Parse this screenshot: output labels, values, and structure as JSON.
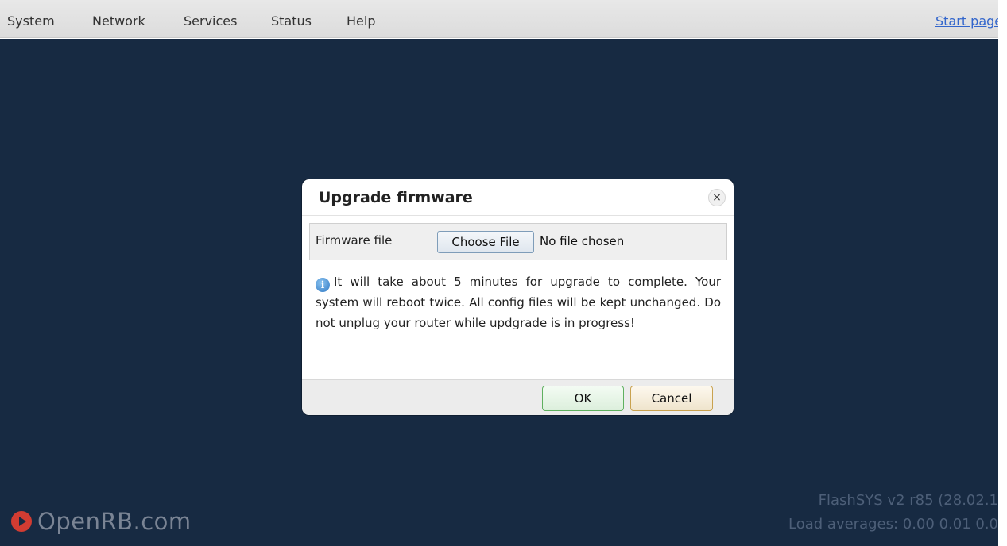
{
  "menu": {
    "items": [
      {
        "label": "System"
      },
      {
        "label": "Network"
      },
      {
        "label": "Services"
      },
      {
        "label": "Status"
      },
      {
        "label": "Help"
      }
    ],
    "start_page": "Start page"
  },
  "dialog": {
    "title": "Upgrade firmware",
    "close_glyph": "×",
    "firmware_label": "Firmware file",
    "choose_file_label": "Choose File",
    "file_status": "No file chosen",
    "info_icon": "info-icon",
    "info_text": "It will take about 5 minutes for upgrade to complete. Your system will reboot twice. All config files will be kept unchanged. Do not unplug your router while updgrade is in progress!",
    "ok_label": "OK",
    "cancel_label": "Cancel"
  },
  "footer": {
    "brand": "OpenRB.com",
    "version": "FlashSYS v2 r85 (28.02.1",
    "load_averages": "Load averages: 0.00 0.01 0.0"
  },
  "colors": {
    "backdrop": "#172a42",
    "menubar": "#e0e0e0",
    "link": "#3366cc",
    "brand_icon": "#d23c32",
    "ok_border": "#5fb05f",
    "cancel_border": "#c9a24f"
  }
}
